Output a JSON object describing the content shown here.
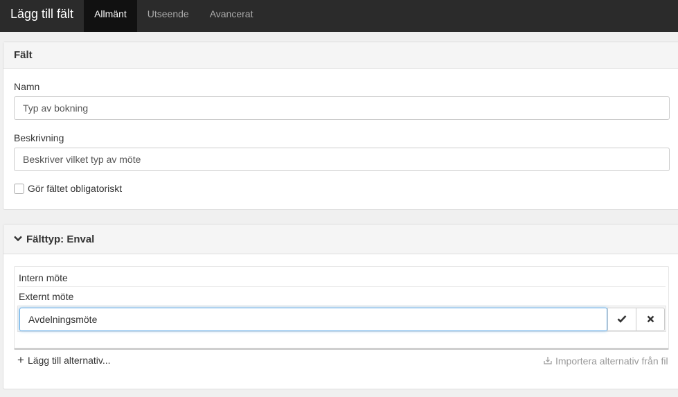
{
  "header": {
    "title": "Lägg till fält",
    "tabs": [
      "Allmänt",
      "Utseende",
      "Avancerat"
    ]
  },
  "field_panel": {
    "heading": "Fält",
    "name_label": "Namn",
    "name_value": "Typ av bokning",
    "description_label": "Beskrivning",
    "description_value": "Beskriver vilket typ av möte",
    "required_label": "Gör fältet obligatoriskt",
    "required_checked": false
  },
  "type_panel": {
    "heading": "Fälttyp: Enval",
    "options": [
      "Intern möte",
      "Externt möte"
    ],
    "editing_value": "Avdelningsmöte",
    "add_label": "Lägg till alternativ...",
    "import_label": "Importera alternativ från fil"
  },
  "icons": {
    "chevron": "chevron-down-icon",
    "confirm": "check-icon",
    "cancel": "close-icon",
    "add": "plus-icon",
    "import": "download-icon"
  },
  "colors": {
    "topbar": "#2b2b2b",
    "active_tab": "#111111",
    "focus_border": "#66afe9"
  }
}
